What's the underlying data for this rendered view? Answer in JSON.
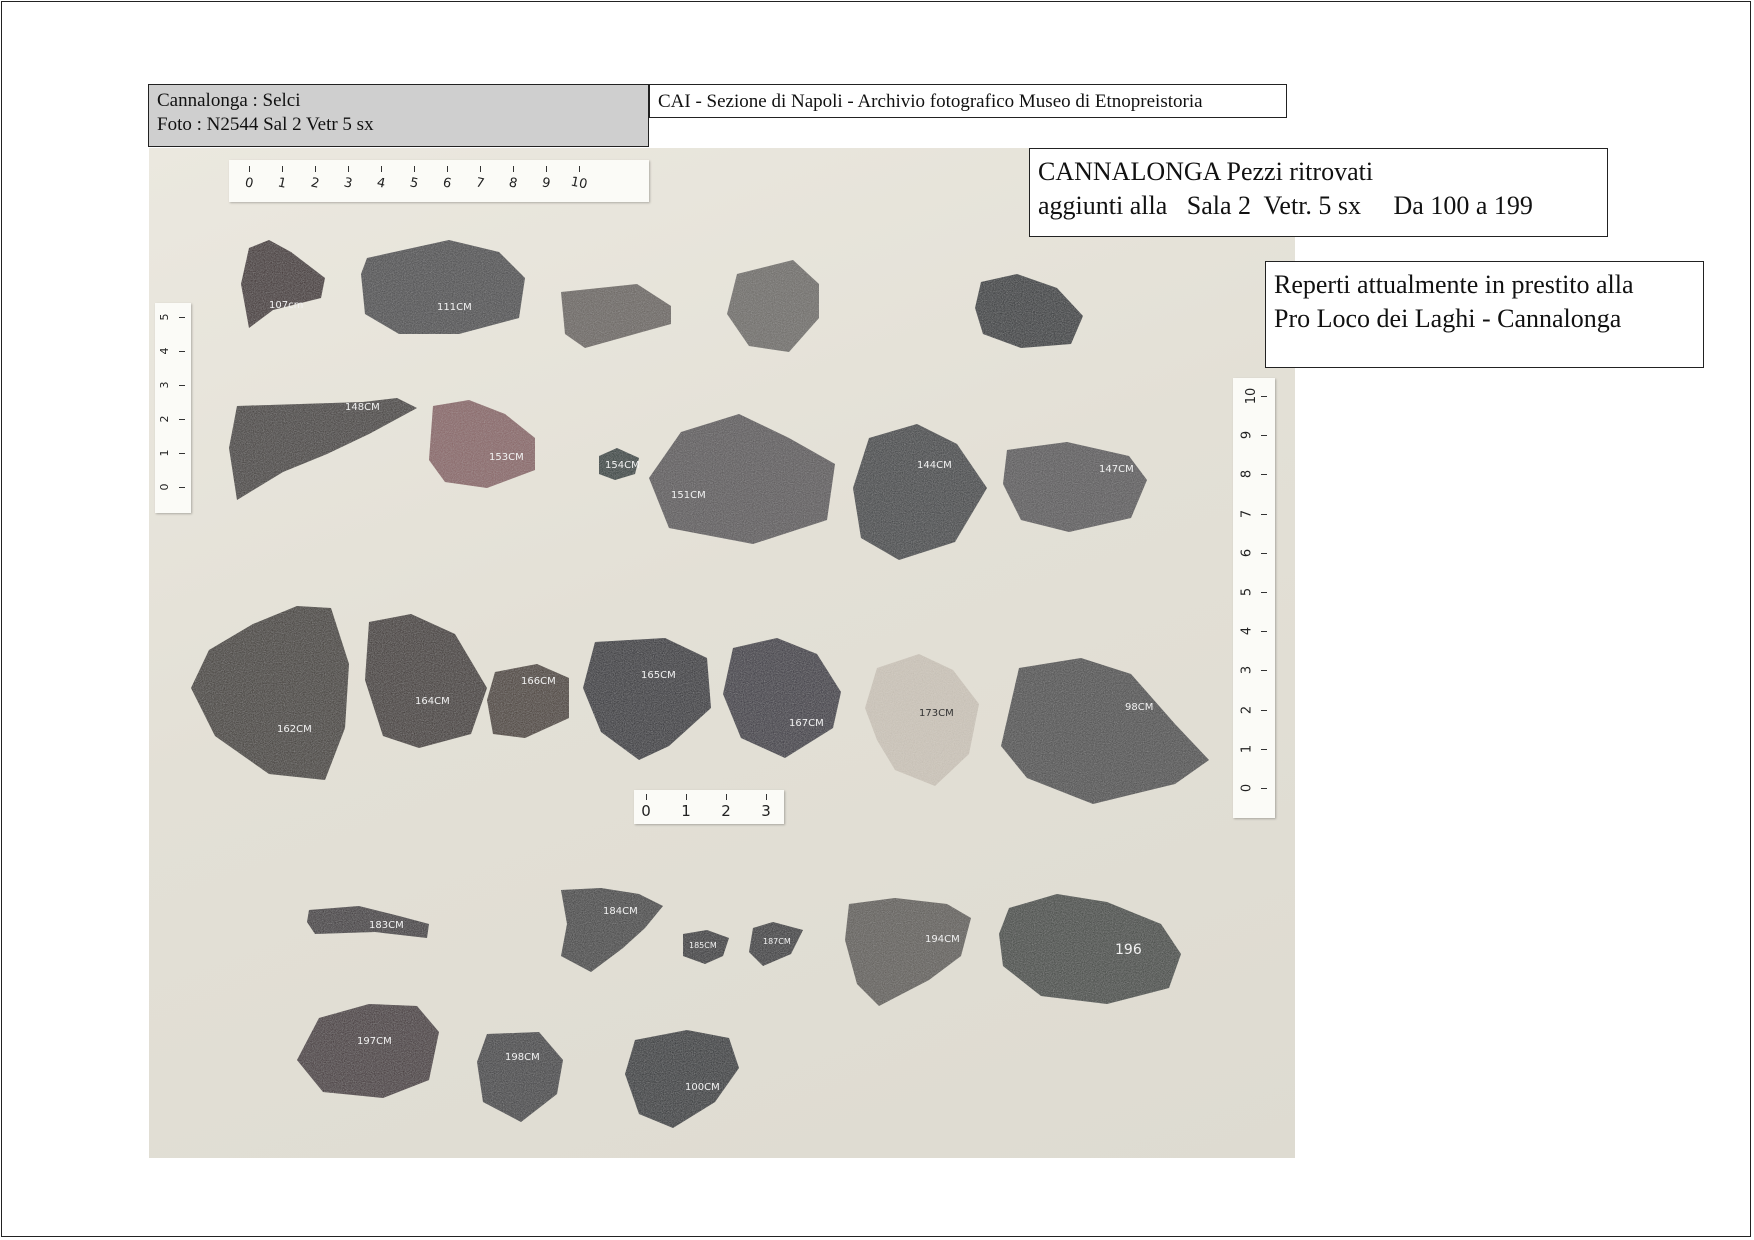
{
  "header": {
    "label_line1": "Cannalonga  :  Selci",
    "label_line2": "Foto : N2544   Sal 2 Vetr 5 sx",
    "archive": "CAI - Sezione di Napoli  - Archivio fotografico Museo di Etnopreistoria"
  },
  "notes": {
    "note1_line1": "CANNALONGA Pezzi ritrovati",
    "note1_line2": "aggiunti alla   Sala 2  Vetr. 5 sx     Da 100 a 199",
    "note2_line1": "Reperti attualmente in prestito alla",
    "note2_line2": "Pro Loco dei Laghi - Cannalonga"
  },
  "rulers": {
    "top": [
      "0",
      "1",
      "2",
      "3",
      "4",
      "5",
      "6",
      "7",
      "8",
      "9",
      "10"
    ],
    "left": [
      "0",
      "1",
      "2",
      "3",
      "4",
      "5"
    ],
    "right": [
      "0",
      "1",
      "2",
      "3",
      "4",
      "5",
      "6",
      "7",
      "8",
      "9",
      "10"
    ],
    "bottom": [
      "0",
      "1",
      "2",
      "3"
    ]
  },
  "fragments": [
    {
      "id": "f107",
      "label": "107cm",
      "color": "#3a2a2c"
    },
    {
      "id": "f111",
      "label": "111CM",
      "color": "#4a4a4c"
    },
    {
      "id": "f-a",
      "label": "",
      "color": "#6b6561"
    },
    {
      "id": "f-b",
      "label": "",
      "color": "#6e6c68"
    },
    {
      "id": "f-c",
      "label": "",
      "color": "#2f3236"
    },
    {
      "id": "f148",
      "label": "148CM",
      "color": "#3f3b37"
    },
    {
      "id": "f153",
      "label": "153CM",
      "color": "#8a6566"
    },
    {
      "id": "f154",
      "label": "154CM",
      "color": "#2a3a38"
    },
    {
      "id": "f151",
      "label": "151CM",
      "color": "#5a5658"
    },
    {
      "id": "f144",
      "label": "144CM",
      "color": "#3d3f42"
    },
    {
      "id": "f147",
      "label": "147CM",
      "color": "#585758"
    },
    {
      "id": "f162",
      "label": "162CM",
      "color": "#3c3830"
    },
    {
      "id": "f164",
      "label": "164CM",
      "color": "#3b332d"
    },
    {
      "id": "f166",
      "label": "166CM",
      "color": "#463a30"
    },
    {
      "id": "f165",
      "label": "165CM",
      "color": "#2a2b33"
    },
    {
      "id": "f167",
      "label": "167CM",
      "color": "#34333d"
    },
    {
      "id": "f173",
      "label": "173CM",
      "color": "#cfc7bb"
    },
    {
      "id": "f98",
      "label": "98CM",
      "color": "#4c4b4c"
    },
    {
      "id": "f183",
      "label": "183CM",
      "color": "#3a3638"
    },
    {
      "id": "f184",
      "label": "184CM",
      "color": "#3f4040"
    },
    {
      "id": "f185",
      "label": "185CM",
      "color": "#2e2e32"
    },
    {
      "id": "f187",
      "label": "187CM",
      "color": "#333235"
    },
    {
      "id": "f194",
      "label": "194CM",
      "color": "#5e5b56"
    },
    {
      "id": "f196",
      "label": "196",
      "color": "#3f4541"
    },
    {
      "id": "f197",
      "label": "197CM",
      "color": "#3f3236"
    },
    {
      "id": "f198",
      "label": "198CM",
      "color": "#3d3c40"
    },
    {
      "id": "f100",
      "label": "100CM",
      "color": "#2c2d33"
    }
  ]
}
